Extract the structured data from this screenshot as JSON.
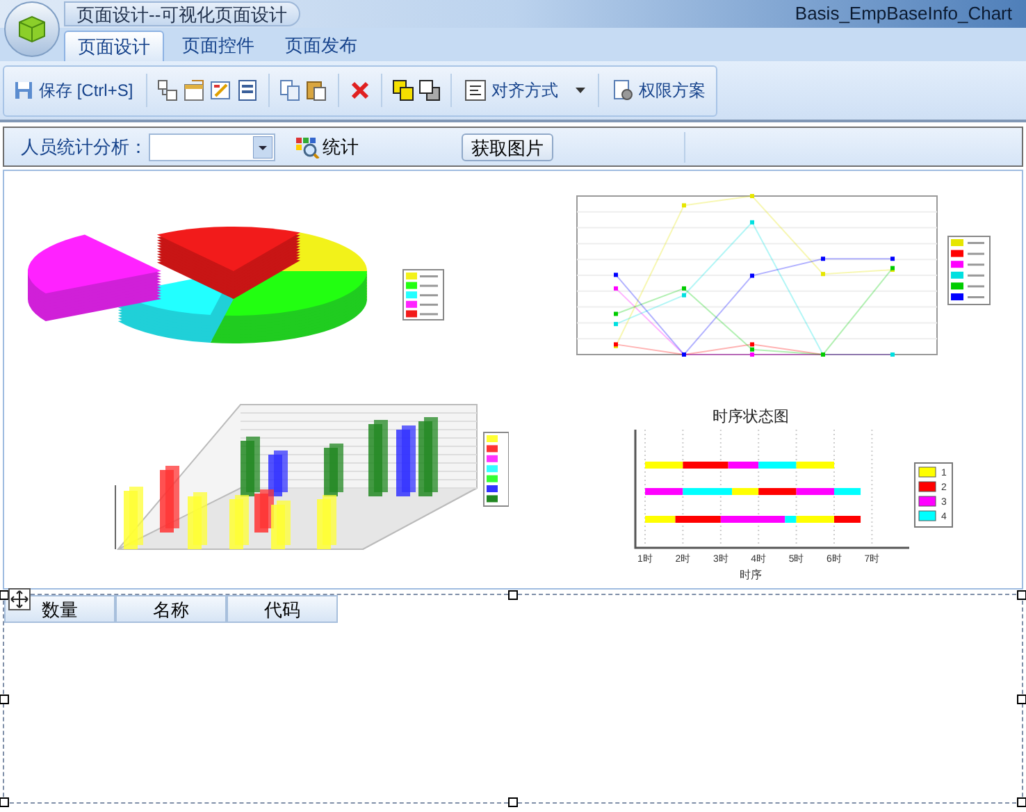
{
  "window": {
    "title": "页面设计--可视化页面设计",
    "document": "Basis_EmpBaseInfo_Chart"
  },
  "tabs": [
    {
      "label": "页面设计",
      "selected": true
    },
    {
      "label": "页面控件",
      "selected": false
    },
    {
      "label": "页面发布",
      "selected": false
    }
  ],
  "toolbar": {
    "save": "保存 [Ctrl+S]",
    "align": "对齐方式",
    "permissions": "权限方案"
  },
  "filter": {
    "label": "人员统计分析：",
    "stat_button": "统计",
    "image_button": "获取图片"
  },
  "timeline_chart": {
    "title": "时序状态图",
    "xlabel": "时序",
    "ticks": [
      "1时",
      "2时",
      "3时",
      "4时",
      "5时",
      "6时",
      "7时"
    ],
    "legend": [
      {
        "label": "1",
        "color": "#ffff00"
      },
      {
        "label": "2",
        "color": "#ff0000"
      },
      {
        "label": "3",
        "color": "#ff00ff"
      },
      {
        "label": "4",
        "color": "#00ffff"
      }
    ]
  },
  "grid": {
    "columns": [
      "数量",
      "名称",
      "代码"
    ]
  }
}
